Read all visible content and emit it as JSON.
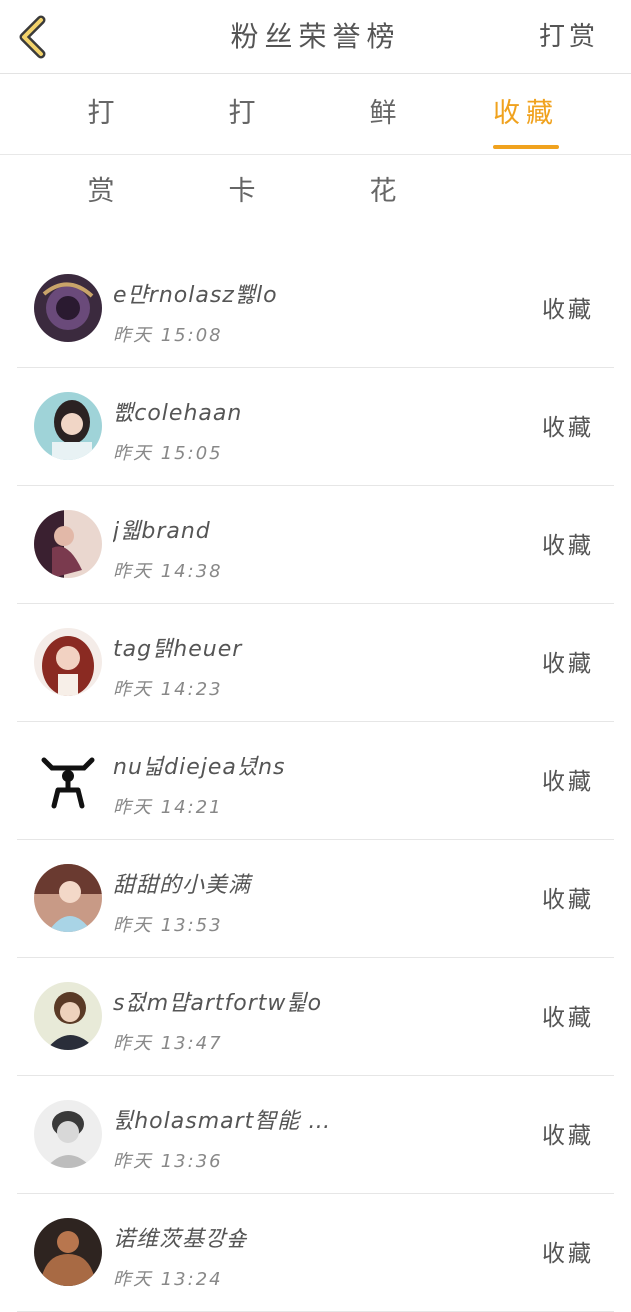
{
  "header": {
    "title": "粉丝荣誉榜",
    "right_button": "打赏",
    "accent_color": "#f0a21e",
    "back_icon": "chevron-left-icon"
  },
  "tabs": [
    {
      "label": "打赏",
      "active": false
    },
    {
      "label": "打卡",
      "active": false
    },
    {
      "label": "鲜花",
      "active": false
    },
    {
      "label": "收藏",
      "active": true
    }
  ],
  "list": [
    {
      "name": "e먄rnolasz뾇lo",
      "time": "昨天 15:08",
      "action": "收藏"
    },
    {
      "name": "뾊colehaan",
      "time": "昨天 15:05",
      "action": "收藏"
    },
    {
      "name": "j웳brand",
      "time": "昨天 14:38",
      "action": "收藏"
    },
    {
      "name": "tag탥heuer",
      "time": "昨天 14:23",
      "action": "收藏"
    },
    {
      "name": "nu넓diejea녔ns",
      "time": "昨天 14:21",
      "action": "收藏"
    },
    {
      "name": "甜甜的小美满",
      "time": "昨天 13:53",
      "action": "收藏"
    },
    {
      "name": "s젒m먑artfortw튍o",
      "time": "昨天 13:47",
      "action": "收藏"
    },
    {
      "name": "튌holasmart智能 …",
      "time": "昨天 13:36",
      "action": "收藏"
    },
    {
      "name": "诺维茨基깡숖",
      "time": "昨天 13:24",
      "action": "收藏"
    }
  ]
}
